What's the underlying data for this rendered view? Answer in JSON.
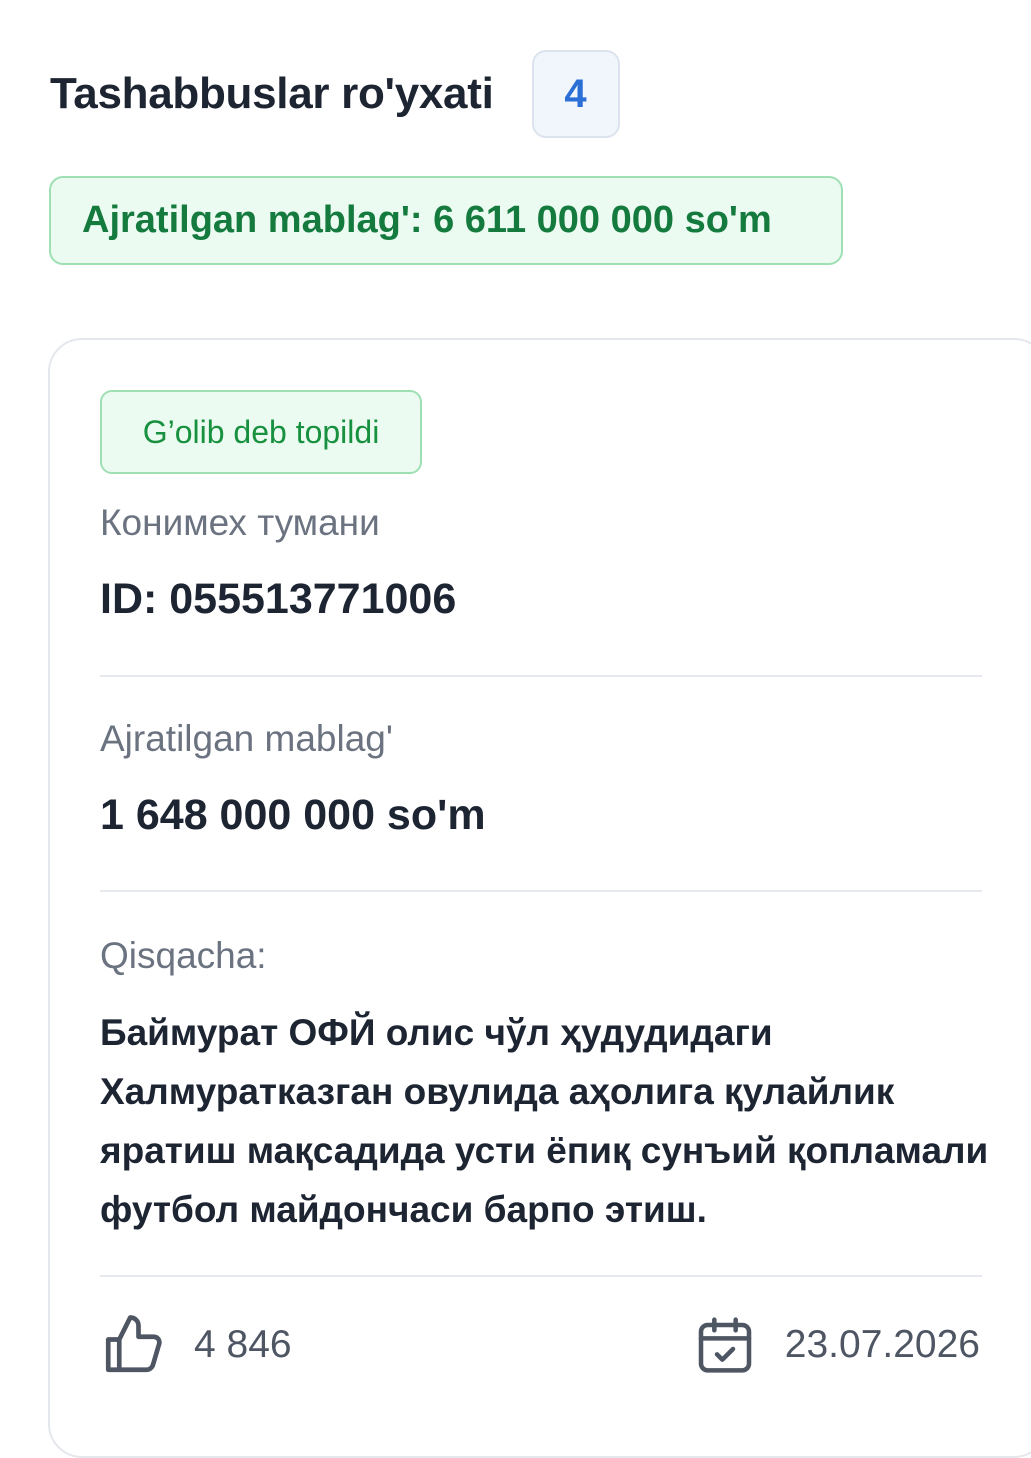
{
  "header": {
    "title": "Tashabbuslar ro'yxati",
    "count": "4"
  },
  "total_budget": "Ajratilgan mablag': 6 611 000 000 so'm",
  "card": {
    "status": "G’olib deb topildi",
    "district": "Конимех тумани",
    "id_text": "ID: 055513771006",
    "budget_label": "Ajratilgan mablag'",
    "budget_value": "1 648 000 000 so'm",
    "summary_label": "Qisqacha:",
    "summary_text": "Баймурат ОФЙ олис чўл ҳудудидаги Халмуратказган овулида аҳолига қулайлик яратиш мақсадида усти ёпиқ сунъий қопламали футбол майдончаси барпо этиш.",
    "likes": "4 846",
    "date": "23.07.2026",
    "like_icon": "thumbs-up-icon",
    "date_icon": "calendar-check-icon"
  },
  "colors": {
    "accent_blue": "#2b6fd6",
    "success_green": "#147a3e",
    "success_bg": "#ecfbf1"
  }
}
